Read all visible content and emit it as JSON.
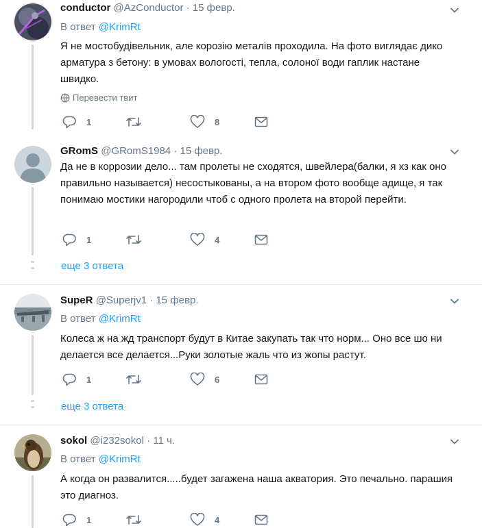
{
  "tweets": [
    {
      "name": "conductor",
      "handle": "@AzConductor",
      "sep": "·",
      "date": "15 февр.",
      "reply_prefix": "В ответ",
      "reply_mention": "@KrimRt",
      "text": "Я не мостобудівельник, але корозію металів проходила. На фото виглядає дико арматура з бетону: в умовах вологості, тепла, солоної води гаплик настане швидко.",
      "translate": "Перевести твит",
      "replies": "1",
      "retweets": "",
      "likes": "8"
    },
    {
      "name": "GRomS",
      "handle": "@GRomS1984",
      "sep": "·",
      "date": "15 февр.",
      "text": "Да не в коррозии дело... там пролеты не сходятся, швейлера(балки, я хз как оно правильно называется) несостыкованы, а на втором фото вообще адище, я так понимаю мостики нагородили чтоб с одного пролета на второй перейти.",
      "replies": "1",
      "retweets": "",
      "likes": "4",
      "more": "еще 3 ответа"
    },
    {
      "name": "SupeR",
      "handle": "@Superjv1",
      "sep": "·",
      "date": "15 февр.",
      "reply_prefix": "В ответ",
      "reply_mention": "@KrimRt",
      "text": "Колеса ж на жд транспорт будут в Китае закупать так что норм... Оно все шо ни делается все делается...Руки золотые жаль что из жопы растут.",
      "replies": "1",
      "retweets": "",
      "likes": "6",
      "more": "еще 3 ответа"
    },
    {
      "name": "sokol",
      "handle": "@i232sokol",
      "sep": "·",
      "date": "11 ч.",
      "reply_prefix": "В ответ",
      "reply_mention": "@KrimRt",
      "text": "А когда он развалится.....будет загажена наша акватория. Это печально. парашия это диагноз.",
      "replies": "1",
      "retweets": "",
      "likes": "4"
    }
  ],
  "icons": {
    "reply": "reply-icon",
    "retweet": "retweet-icon",
    "like": "heart-icon",
    "dm": "envelope-icon",
    "caret": "chevron-down-icon",
    "translate": "globe-icon"
  },
  "colors": {
    "link": "#1da1f2",
    "muted": "#657786",
    "text": "#14171a",
    "divider": "#e6ecf0"
  }
}
